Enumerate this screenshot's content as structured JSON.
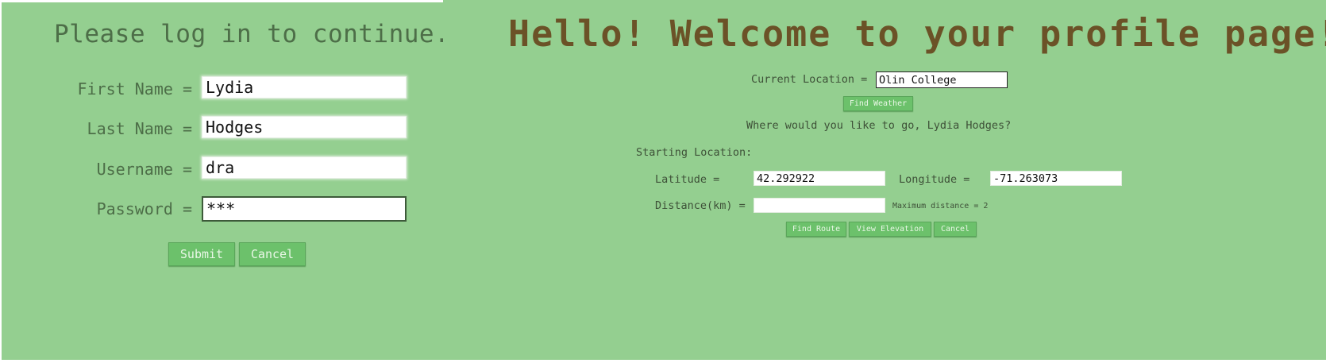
{
  "login": {
    "title": "Please log in to continue.",
    "fields": [
      {
        "label": "First Name =",
        "value": "Lydia"
      },
      {
        "label": "Last Name =",
        "value": "Hodges"
      },
      {
        "label": "Username =",
        "value": "dra"
      },
      {
        "label": "Password =",
        "value": "***"
      }
    ],
    "submit_label": "Submit",
    "cancel_label": "Cancel"
  },
  "profile": {
    "title": "Hello! Welcome to your profile page!",
    "current_location_label": "Current Location =",
    "current_location_value": "Olin College",
    "find_weather_label": "Find Weather",
    "question": "Where would you like to go, Lydia Hodges?",
    "starting_location_label": "Starting Location:",
    "latitude_label": "Latitude =",
    "latitude_value": "42.292922",
    "longitude_label": "Longitude =",
    "longitude_value": "-71.263073",
    "distance_label": "Distance(km) =",
    "distance_value": "",
    "max_distance_note": "Maximum distance = 2",
    "find_route_label": "Find Route",
    "view_elevation_label": "View Elevation",
    "cancel_label": "Cancel"
  },
  "colors": {
    "panel_background": "#94cf90",
    "button_green": "#6cc16b",
    "profile_title": "#6b5227",
    "login_text": "#4d6e48"
  }
}
